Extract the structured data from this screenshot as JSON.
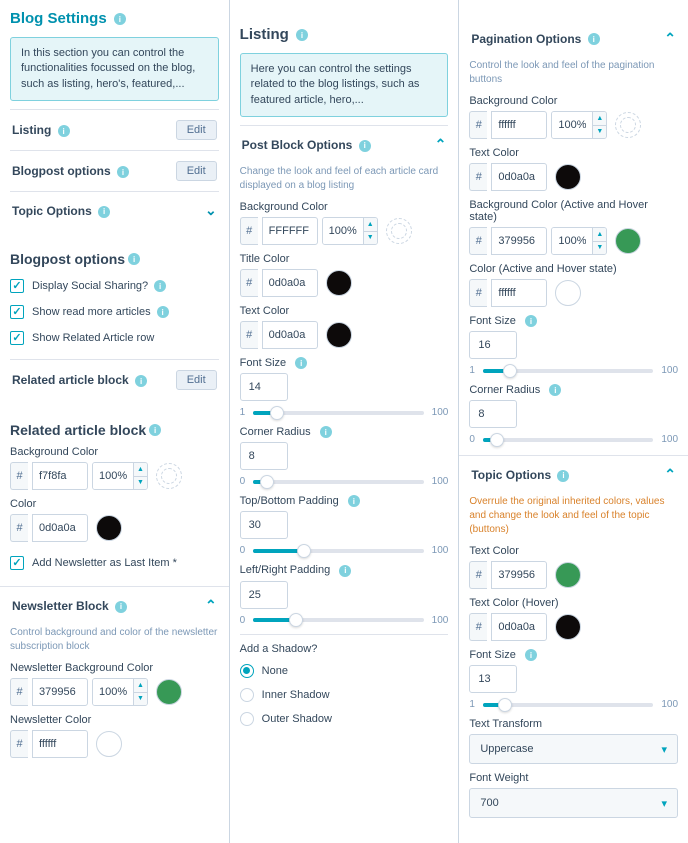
{
  "col1": {
    "header": "Blog Settings",
    "info": "In this section you can control the functionalities focussed on the blog, such as listing, hero's, featured,...",
    "rows": {
      "listing": {
        "label": "Listing",
        "btn": "Edit"
      },
      "blogpost_opts": {
        "label": "Blogpost options",
        "btn": "Edit"
      },
      "topic_opts": {
        "label": "Topic Options"
      }
    },
    "blogpost_options": {
      "title": "Blogpost options",
      "cb_social": "Display Social Sharing?",
      "cb_readmore": "Show read more articles",
      "cb_related": "Show Related Article row"
    },
    "related_row": {
      "label": "Related article block",
      "btn": "Edit"
    },
    "related_block": {
      "title": "Related article block",
      "bg_label": "Background Color",
      "bg_hex": "f7f8fa",
      "bg_pct": "100%",
      "color_label": "Color",
      "color_hex": "0d0a0a",
      "cb_newsletter": "Add Newsletter as Last Item *"
    },
    "newsletter_block": {
      "title": "Newsletter Block",
      "help": "Control background and color of the newsletter subscription block",
      "bg_label": "Newsletter Background Color",
      "bg_hex": "379956",
      "bg_pct": "100%",
      "color_label": "Newsletter Color",
      "color_hex": "ffffff"
    }
  },
  "col2": {
    "header": "Listing",
    "info": "Here you can control the settings related to the blog listings, such as featured article, hero,...",
    "post_block": {
      "title": "Post Block Options",
      "help": "Change the look and feel of each article card displayed on a blog listing",
      "bg_label": "Background Color",
      "bg_hex": "FFFFFF",
      "bg_pct": "100%",
      "title_label": "Title Color",
      "title_hex": "0d0a0a",
      "text_label": "Text Color",
      "text_hex": "0d0a0a",
      "font_label": "Font Size",
      "font_val": "14",
      "radius_label": "Corner Radius",
      "radius_val": "8",
      "tb_label": "Top/Bottom Padding",
      "tb_val": "30",
      "lr_label": "Left/Right Padding",
      "lr_val": "25",
      "shadow_label": "Add a Shadow?",
      "shadow_none": "None",
      "shadow_inner": "Inner Shadow",
      "shadow_outer": "Outer Shadow",
      "min1": "1",
      "max100": "100",
      "min0": "0"
    }
  },
  "col3": {
    "pagination": {
      "title": "Pagination Options",
      "help": "Control the look and feel of the pagination buttons",
      "bg_label": "Background Color",
      "bg_hex": "ffffff",
      "bg_pct": "100%",
      "text_label": "Text Color",
      "text_hex": "0d0a0a",
      "bg_active_label": "Background Color (Active and Hover state)",
      "bg_active_hex": "379956",
      "bg_active_pct": "100%",
      "color_active_label": "Color (Active and Hover state)",
      "color_active_hex": "ffffff",
      "font_label": "Font Size",
      "font_val": "16",
      "radius_label": "Corner Radius",
      "radius_val": "8",
      "min1": "1",
      "max100": "100",
      "min0": "0"
    },
    "topic": {
      "title": "Topic Options",
      "help": "Overrule the original inherited colors, values and change the look and feel of the topic (buttons)",
      "text_label": "Text Color",
      "text_hex": "379956",
      "hover_label": "Text Color (Hover)",
      "hover_hex": "0d0a0a",
      "font_label": "Font Size",
      "font_val": "13",
      "transform_label": "Text Transform",
      "transform_val": "Uppercase",
      "weight_label": "Font Weight",
      "weight_val": "700",
      "min1": "1",
      "max100": "100"
    }
  }
}
